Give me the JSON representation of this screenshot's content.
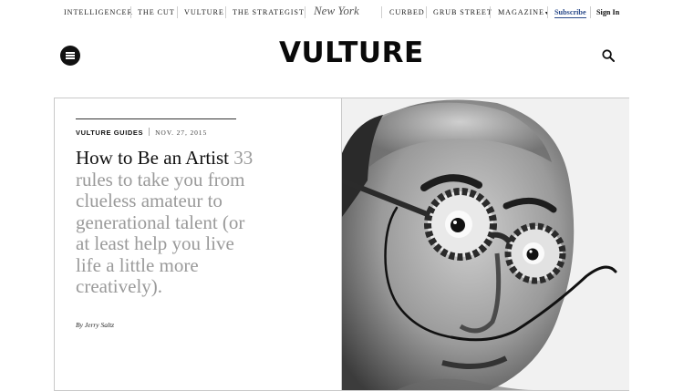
{
  "network_nav": {
    "items": [
      "INTELLIGENCER",
      "THE CUT",
      "VULTURE",
      "THE STRATEGIST",
      "CURBED",
      "GRUB STREET",
      "MAGAZINE"
    ],
    "brand": "New York",
    "subscribe_label": "Subscribe",
    "signin_label": "Sign In",
    "magazine_has_dropdown": true
  },
  "header": {
    "logo": "VULTURE",
    "menu_icon": "hamburger-menu-icon",
    "search_icon": "search-icon"
  },
  "feature": {
    "kicker": "VULTURE GUIDES",
    "date": "NOV. 27, 2015",
    "headline": "How to Be an Artist",
    "dek": "33 rules to take you from clueless amateur to generational talent (or at least help you live life a little more creatively).",
    "byline": "By Jerry Saltz",
    "image_alt": "Black and white portrait of a man with round tortoiseshell glasses and a long upturned mustache"
  }
}
